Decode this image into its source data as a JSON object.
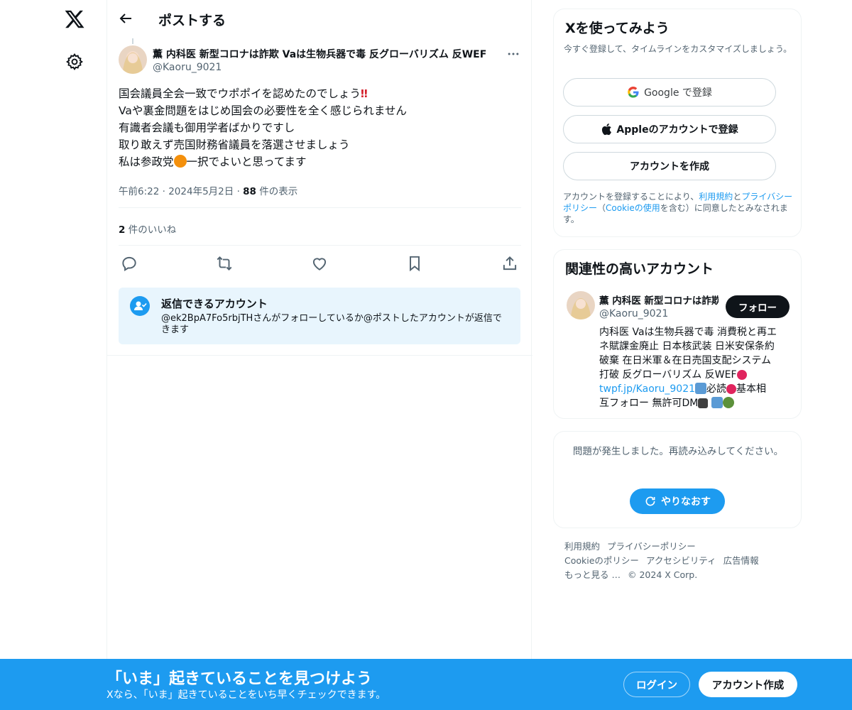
{
  "nav": {
    "logo_icon": "x-logo-icon",
    "settings_icon": "gear-icon"
  },
  "header": {
    "title": "ポストする",
    "back_icon": "arrow-left-icon"
  },
  "post": {
    "author_name": "薫 内科医 新型コロナは詐欺 Vaは生物兵器で毒 反グローバリズム 反WEF",
    "author_handle": "@Kaoru_9021",
    "lines": [
      "国会議員全会一致でウポポイを認めたのでしょう",
      "Vaや裏金問題をはじめ国会の必要性を全く感じられません",
      "有識者会議も御用学者ばかりですし",
      "取り敢えず売国財務省議員を落選させましょう",
      "私は参政党",
      "一択でよいと思ってます"
    ],
    "emoji_double_exclamation": "‼",
    "time": "午前6:22",
    "date": "2024年5月2日",
    "views_count": "88",
    "views_label": "件の表示",
    "likes_count": "2",
    "likes_label": "件のいいね"
  },
  "reply_notice": {
    "title": "返信できるアカウント",
    "body": "@ek2BpA7Fo5rbjTHさんがフォローしているか@ポストしたアカウントが返信できます"
  },
  "signup_card": {
    "title": "Xを使ってみよう",
    "subtitle": "今すぐ登録して、タイムラインをカスタマイズしましょう。",
    "google_label": "Google で登録",
    "apple_label": "Appleのアカウントで登録",
    "create_label": "アカウントを作成",
    "legal_prefix": "アカウントを登録することにより、",
    "legal_terms": "利用規約",
    "legal_and": "と",
    "legal_privacy": "プライバシーポリシー",
    "legal_open": "（",
    "legal_cookie": "Cookieの使用",
    "legal_suffix": "を含む）に同意したとみなされます。"
  },
  "related": {
    "title": "関連性の高いアカウント",
    "name": "薫 内科医 新型コロナは詐欺 Vaは生物兵器で毒 反グローバリズム 反WEF",
    "handle": "@Kaoru_9021",
    "follow_label": "フォロー",
    "bio_lines": [
      "内科医 Vaは生物兵器で毒 消費税と再エ",
      "ネ賦課金廃止 日本核武装 日米安保条約",
      "破棄 在日米軍＆在日売国支配システム",
      "打破 反グローバリズム 反WEF"
    ],
    "bio_link": "twpf.jp/Kaoru_9021",
    "bio_after_link": "必読",
    "bio_after_ribbon": "基本相",
    "bio_last": "互フォロー 無許可DM"
  },
  "error_card": {
    "message": "問題が発生しました。再読み込みしてください。",
    "retry_label": "やりなおす"
  },
  "footer": {
    "links": [
      "利用規約",
      "プライバシーポリシー",
      "Cookieのポリシー",
      "アクセシビリティ",
      "広告情報",
      "もっと見る …",
      "© 2024 X Corp."
    ]
  },
  "banner": {
    "title": "「いま」起きていることを見つけよう",
    "subtitle": "Xなら、「いま」起きていることをいち早くチェックできます。",
    "login_label": "ログイン",
    "signup_label": "アカウント作成"
  },
  "colors": {
    "accent": "#1d9bf0",
    "text": "#0f1419",
    "muted": "#536471"
  }
}
